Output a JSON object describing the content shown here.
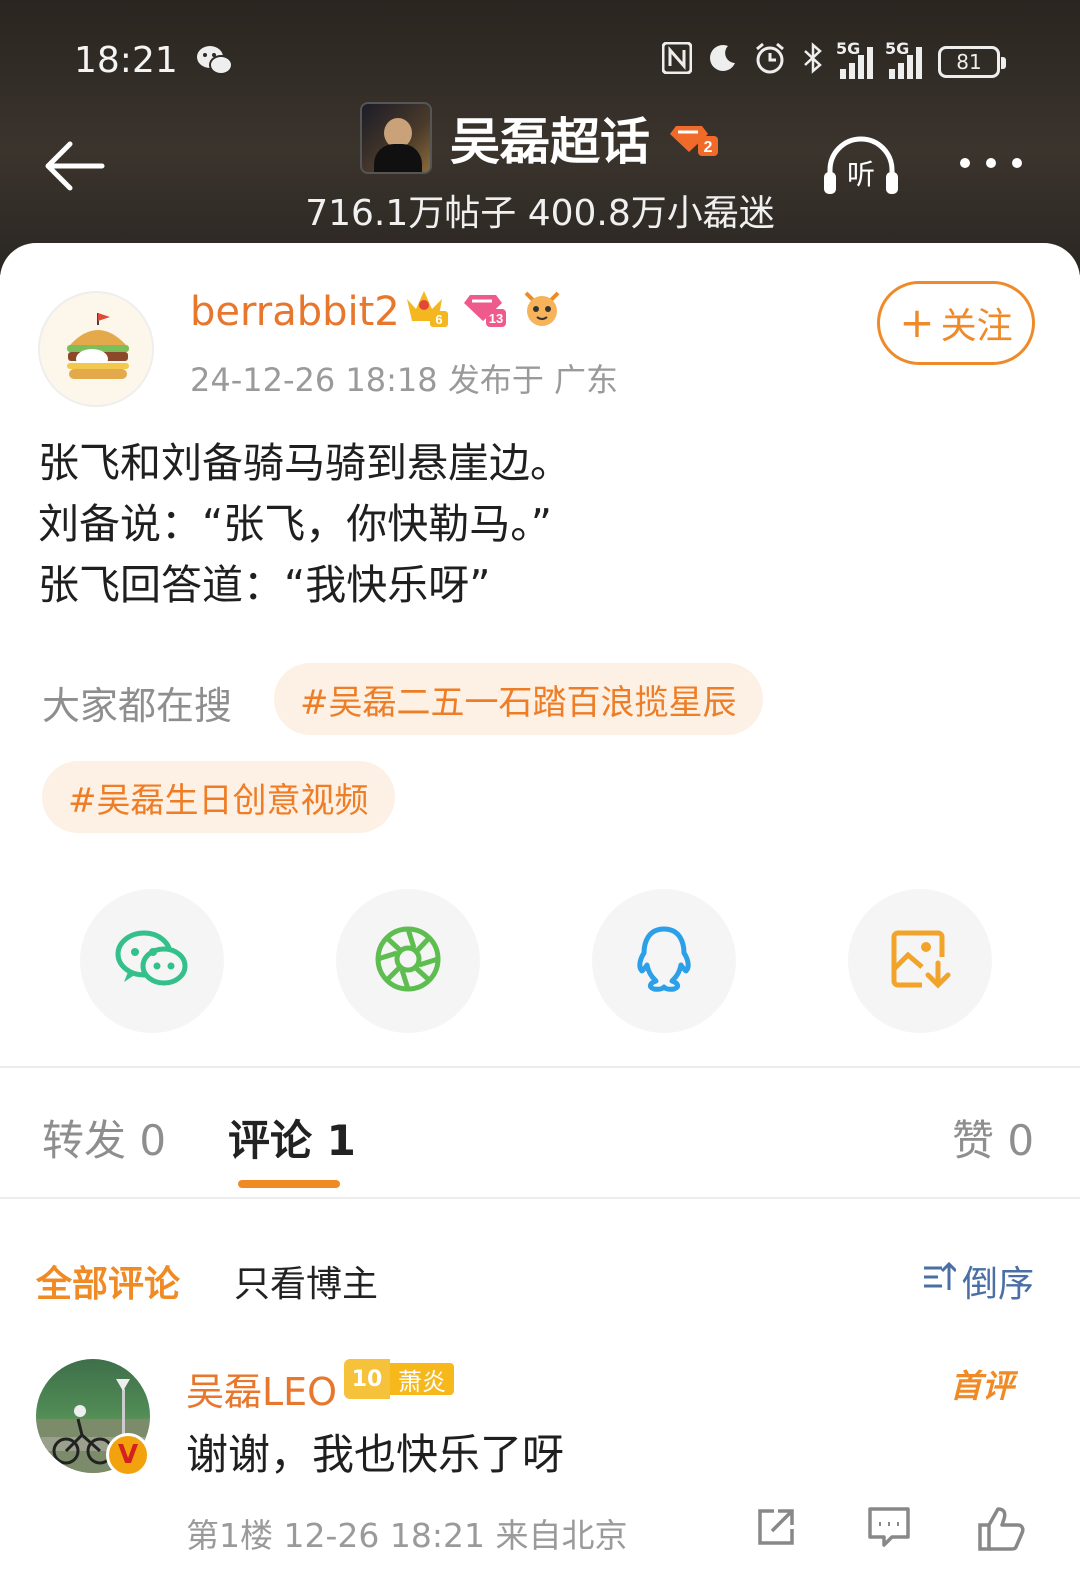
{
  "status_bar": {
    "time": "18:21",
    "network_1": "5G",
    "network_2": "5G",
    "battery": "81"
  },
  "header": {
    "title": "吴磊超话",
    "stats": "716.1万帖子 400.8万小磊迷",
    "listen_label": "听",
    "level_badge": "2"
  },
  "post": {
    "author": "berrabbit2",
    "badges": {
      "crown_level": "6",
      "diamond_level": "13"
    },
    "meta": "24-12-26 18:18  发布于 广东",
    "follow_label": "关注",
    "follow_plus": "+",
    "lines": [
      "张飞和刘备骑马骑到悬崖边。",
      "刘备说：“张飞，你快勒马。”",
      "张飞回答道：“我快乐呀”"
    ]
  },
  "search": {
    "label": "大家都在搜",
    "tags": [
      "#吴磊二五一石踏百浪揽星辰",
      "#吴磊生日创意视频"
    ]
  },
  "share": {
    "icons": [
      "wechat-icon",
      "moments-icon",
      "qq-icon",
      "save-image-icon"
    ]
  },
  "tabs": [
    {
      "label": "转发 0"
    },
    {
      "label": "评论 1"
    },
    {
      "label": "赞 0"
    }
  ],
  "filters": {
    "all": "全部评论",
    "author_only": "只看博主",
    "sort": "倒序"
  },
  "comment": {
    "user": "吴磊LEO",
    "badge_level": "10",
    "badge_name": "萧炎",
    "first_label": "首评",
    "verified": "V",
    "text": "谢谢，我也快乐了呀",
    "meta": "第1楼 12-26 18:21 来自北京"
  },
  "colors": {
    "accent": "#f08a24",
    "name_orange": "#e8772e",
    "tag_bg": "#fdf0e4",
    "link_blue": "#4a6fa5"
  }
}
